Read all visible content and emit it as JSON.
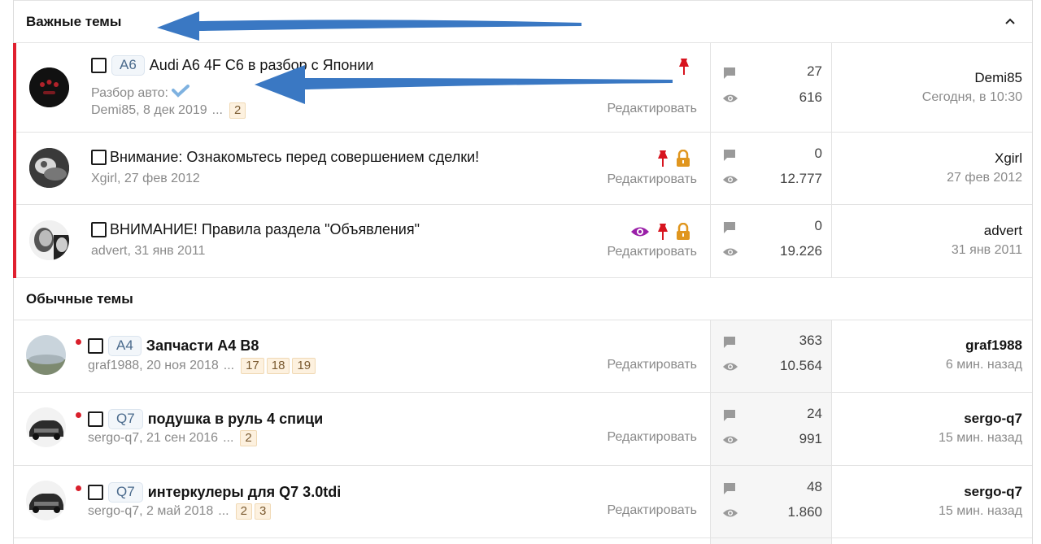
{
  "sections": {
    "important_title": "Важные темы",
    "regular_title": "Обычные темы"
  },
  "threads": [
    {
      "prefix": "A6",
      "title": "Audi A6 4F C6 в разбор с Японии",
      "thread_prefix_label": "Разбор авто:",
      "author": "Demi85",
      "date": ", 8 дек 2019",
      "ellipsis": "...",
      "pages": [
        "2"
      ],
      "edit": "Редактировать",
      "replies": "27",
      "views": "616",
      "last_user": "Demi85",
      "last_time": "Сегодня, в 10:30",
      "icons": [
        "pin-icon"
      ]
    },
    {
      "prefix": "",
      "title": "Внимание: Ознакомьтесь перед совершением сделки!",
      "author": "Xgirl",
      "date": ", 27 фев 2012",
      "edit": "Редактировать",
      "replies": "0",
      "views": "12.777",
      "last_user": "Xgirl",
      "last_time": "27 фев 2012",
      "icons": [
        "pin-icon",
        "lock-icon"
      ]
    },
    {
      "prefix": "",
      "title": "ВНИМАНИЕ! Правила раздела \"Объявления\"",
      "author": "advert",
      "date": ", 31 янв 2011",
      "edit": "Редактировать",
      "replies": "0",
      "views": "19.226",
      "last_user": "advert",
      "last_time": "31 янв 2011",
      "icons": [
        "watch-eye-icon",
        "pin-icon",
        "lock-icon"
      ]
    },
    {
      "prefix": "A4",
      "title": "Запчасти А4 В8",
      "author": "graf1988",
      "date": ", 20 ноя 2018",
      "ellipsis": "...",
      "pages": [
        "17",
        "18",
        "19"
      ],
      "edit": "Редактировать",
      "replies": "363",
      "views": "10.564",
      "last_user": "graf1988",
      "last_time": "6 мин. назад"
    },
    {
      "prefix": "Q7",
      "title": "подушка в руль 4 спици",
      "author": "sergo-q7",
      "date": ", 21 сен 2016",
      "ellipsis": "...",
      "pages": [
        "2"
      ],
      "edit": "Редактировать",
      "replies": "24",
      "views": "991",
      "last_user": "sergo-q7",
      "last_time": "15 мин. назад"
    },
    {
      "prefix": "Q7",
      "title": "интеркулеры для Q7 3.0tdi",
      "author": "sergo-q7",
      "date": ", 2 май 2018",
      "ellipsis": "...",
      "pages": [
        "2",
        "3"
      ],
      "edit": "Редактировать",
      "replies": "48",
      "views": "1.860",
      "last_user": "sergo-q7",
      "last_time": "15 мин. назад"
    }
  ],
  "colors": {
    "accent_red": "#e0202f",
    "arrow_blue": "#3a78c3",
    "prefix_text": "#4a6a8c",
    "page_chip_bg": "#fdf1df",
    "lock_orange": "#e0961f",
    "watch_purple": "#9a1fa8"
  }
}
